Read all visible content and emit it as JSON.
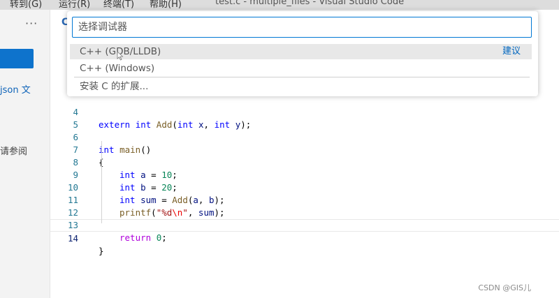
{
  "menubar": {
    "items": [
      {
        "label": "转到(G)"
      },
      {
        "label": "运行(R)"
      },
      {
        "label": "终端(T)"
      },
      {
        "label": "帮助(H)"
      }
    ],
    "window_title": "test.c - multiple_files - Visual Studio Code"
  },
  "sidebar": {
    "more_icon": "ellipsis-icon",
    "text1": "json 文",
    "text2": "请参阅"
  },
  "tab": {
    "icon_label": "C"
  },
  "quickpick": {
    "placeholder": "选择调试器",
    "items": [
      {
        "label": "C++ (GDB/LLDB)",
        "badge": "建议"
      },
      {
        "label": "C++ (Windows)"
      },
      {
        "label": "安装 C 的扩展..."
      }
    ]
  },
  "editor": {
    "line_numbers": [
      "4",
      "5",
      "6",
      "7",
      "8",
      "9",
      "10",
      "11",
      "12",
      "13",
      "14"
    ],
    "lines": {
      "l4": {
        "kw1": "extern",
        "kw2": "int",
        "fn": "Add",
        "p1": "(",
        "kw3": "int",
        "v1": " x",
        "p2": ", ",
        "kw4": "int",
        "v2": " y",
        "p3": ");"
      },
      "l6": {
        "kw": "int",
        "fn": " main",
        "p": "()"
      },
      "l7": {
        "p": "{"
      },
      "l8": {
        "kw": "int",
        "v": " a",
        "op": " = ",
        "num": "10",
        "end": ";"
      },
      "l9": {
        "kw": "int",
        "v": " b",
        "op": " = ",
        "num": "20",
        "end": ";"
      },
      "l10": {
        "kw": "int",
        "v": " sum",
        "op": " = ",
        "fn": "Add",
        "p1": "(",
        "v1": "a",
        "p2": ", ",
        "v2": "b",
        "p3": ");"
      },
      "l11": {
        "fn": "printf",
        "p1": "(",
        "str1": "\"%d",
        "esc": "\\n",
        "str2": "\"",
        "p2": ", ",
        "v": "sum",
        "p3": ");"
      },
      "l13": {
        "kw": "return",
        "sp": " ",
        "num": "0",
        "end": ";"
      },
      "l14": {
        "p": "}"
      }
    }
  },
  "watermark": "CSDN @GIS儿"
}
